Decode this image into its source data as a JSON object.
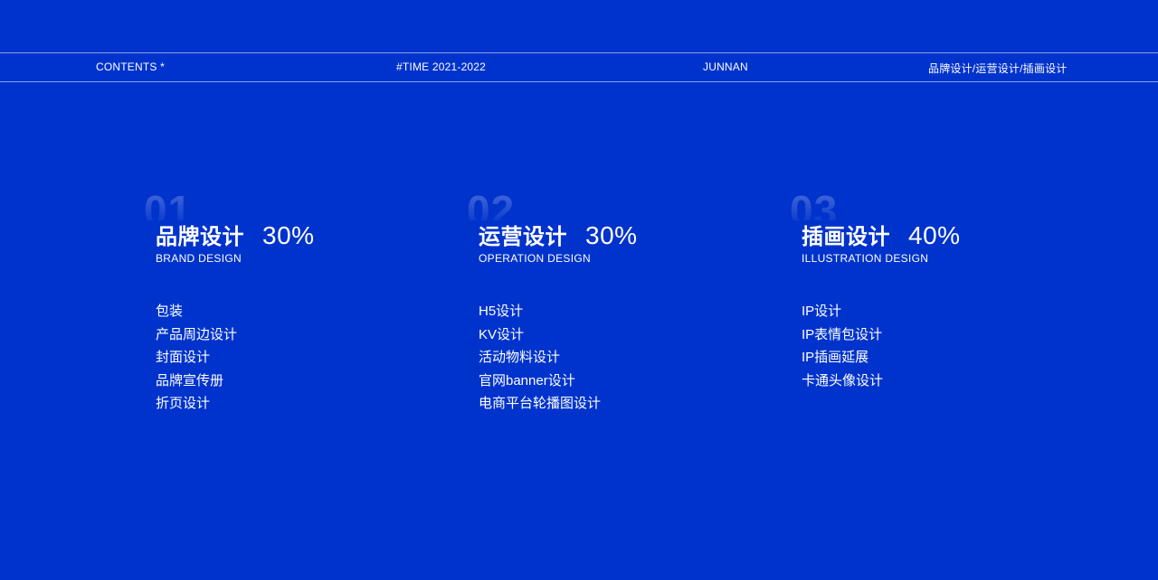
{
  "header": {
    "contents": "CONTENTS *",
    "time": "#TIME  2021-2022",
    "author": "JUNNAN",
    "categories": "品牌设计/运营设计/插画设计"
  },
  "sections": [
    {
      "number": "01",
      "title": "品牌设计",
      "percent": "30%",
      "subtitle": "BRAND DESIGN",
      "items": [
        "包装",
        "产品周边设计",
        "封面设计",
        "品牌宣传册",
        "折页设计"
      ]
    },
    {
      "number": "02",
      "title": "运营设计",
      "percent": "30%",
      "subtitle": "OPERATION DESIGN",
      "items": [
        "H5设计",
        "KV设计",
        "活动物料设计",
        "官网banner设计",
        "电商平台轮播图设计"
      ]
    },
    {
      "number": "03",
      "title": "插画设计",
      "percent": "40%",
      "subtitle": "ILLUSTRATION DESIGN",
      "items": [
        "IP设计",
        "IP表情包设计",
        "IP插画延展",
        "卡通头像设计"
      ]
    }
  ],
  "colors": {
    "background": "#0033CC",
    "text": "#FFFFFF"
  }
}
